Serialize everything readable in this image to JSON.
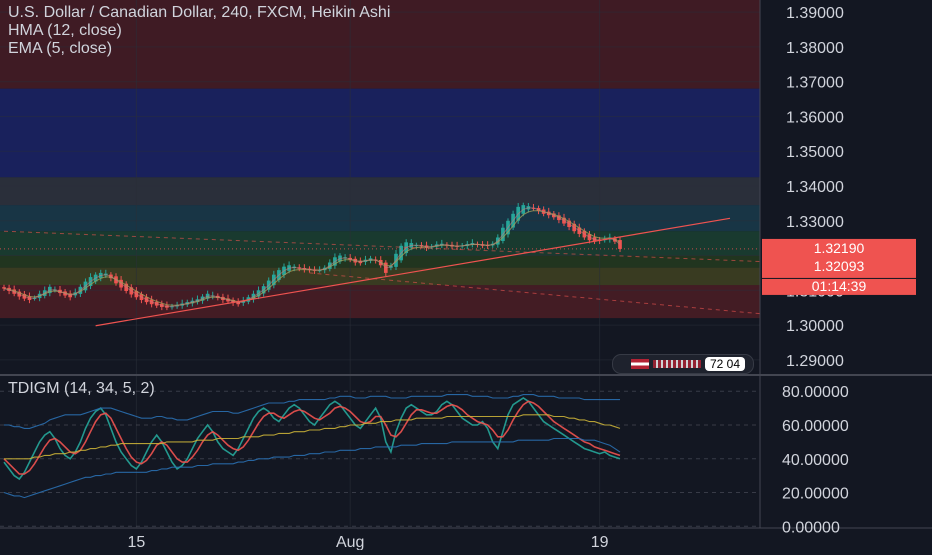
{
  "legend": {
    "main": "U.S. Dollar / Canadian Dollar, 240, FXCM, Heikin Ashi",
    "hma": "HMA (12, close)",
    "ema": "EMA (5, close)",
    "indicator": "TDIGM (14, 34, 5, 2)"
  },
  "price_tags": {
    "last": "1.32190",
    "second": "1.32093",
    "countdown": "01:14:39"
  },
  "logo": {
    "text": "72 04"
  },
  "colors": {
    "background": "#131722",
    "up": "#26a69a",
    "down": "#ef5350",
    "axis_text": "#d1d4dc",
    "price_tag_bg": "#ef5350",
    "tdi_green": "#26a69a",
    "tdi_red": "#ef5350",
    "tdi_yellow": "#c9b037",
    "tdi_bands": "#2a6fb0",
    "trendline": "#ef5350"
  },
  "chart_data": [
    {
      "type": "candlestick",
      "title": "U.S. Dollar / Canadian Dollar, 240, FXCM, Heikin Ashi",
      "y_ticks": [
        "1.39000",
        "1.38000",
        "1.37000",
        "1.36000",
        "1.35000",
        "1.34000",
        "1.33000",
        "1.32000",
        "1.31000",
        "1.30000",
        "1.29000"
      ],
      "ylim": [
        1.2865,
        1.3935
      ],
      "x_ticks": [
        "15",
        "Aug",
        "19"
      ],
      "x_tick_positions": [
        26,
        68,
        117
      ],
      "bar_count": 122,
      "zones": [
        {
          "from": 1.368,
          "to": 1.3935,
          "color": "#b2272c",
          "alpha": 0.28
        },
        {
          "from": 1.3425,
          "to": 1.368,
          "color": "#1f2a8c",
          "alpha": 0.55
        },
        {
          "from": 1.3345,
          "to": 1.3425,
          "color": "#3a3f4b",
          "alpha": 0.6
        },
        {
          "from": 1.327,
          "to": 1.3345,
          "color": "#1d4e63",
          "alpha": 0.55
        },
        {
          "from": 1.32,
          "to": 1.327,
          "color": "#1e5238",
          "alpha": 0.6
        },
        {
          "from": 1.3165,
          "to": 1.32,
          "color": "#2c4a1e",
          "alpha": 0.6
        },
        {
          "from": 1.3115,
          "to": 1.3165,
          "color": "#545422",
          "alpha": 0.6
        },
        {
          "from": 1.302,
          "to": 1.3115,
          "color": "#b2272c",
          "alpha": 0.3
        }
      ],
      "close": [
        1.3105,
        1.3098,
        1.309,
        1.3082,
        1.3076,
        1.3072,
        1.3078,
        1.309,
        1.31,
        1.311,
        1.3102,
        1.3092,
        1.3085,
        1.308,
        1.3094,
        1.311,
        1.3125,
        1.3138,
        1.3145,
        1.315,
        1.3148,
        1.3135,
        1.312,
        1.3108,
        1.3098,
        1.3088,
        1.308,
        1.3072,
        1.3066,
        1.306,
        1.3056,
        1.3052,
        1.305,
        1.3054,
        1.3058,
        1.3062,
        1.3066,
        1.307,
        1.3074,
        1.3082,
        1.309,
        1.3085,
        1.3078,
        1.3072,
        1.3068,
        1.3064,
        1.306,
        1.307,
        1.308,
        1.309,
        1.31,
        1.3112,
        1.3128,
        1.3145,
        1.3158,
        1.3168,
        1.3172,
        1.3168,
        1.3162,
        1.316,
        1.3158,
        1.3156,
        1.3158,
        1.3165,
        1.318,
        1.3195,
        1.32,
        1.3195,
        1.3188,
        1.318,
        1.3178,
        1.3188,
        1.3192,
        1.3186,
        1.3172,
        1.315,
        1.317,
        1.3205,
        1.3228,
        1.3238,
        1.3236,
        1.323,
        1.3228,
        1.3222,
        1.3226,
        1.3232,
        1.3234,
        1.323,
        1.3226,
        1.3225,
        1.3229,
        1.3233,
        1.3236,
        1.3232,
        1.3228,
        1.3228,
        1.3234,
        1.3252,
        1.328,
        1.33,
        1.332,
        1.334,
        1.3345,
        1.3342,
        1.3336,
        1.3328,
        1.332,
        1.3316,
        1.331,
        1.3302,
        1.3292,
        1.3282,
        1.327,
        1.3262,
        1.3252,
        1.3244,
        1.324,
        1.3242,
        1.3248,
        1.3252,
        1.324,
        1.3219
      ],
      "last_price": 1.3219,
      "second_price": 1.32093,
      "trendline": [
        {
          "bar": 18,
          "price": 1.2998
        },
        {
          "bar": 121,
          "price": 1.3307
        }
      ],
      "dashed_lines": [
        {
          "from": {
            "bar": 0,
            "price": 1.327
          },
          "to": {
            "bar": 121,
            "price": 1.32
          },
          "color": "#ef5350"
        },
        {
          "from": {
            "bar": 60,
            "price": 1.315
          },
          "to": {
            "bar": 121,
            "price": 1.305
          },
          "color": "#ef5350"
        }
      ]
    },
    {
      "type": "line",
      "title": "TDIGM (14, 34, 5, 2)",
      "y_ticks": [
        "80.00000",
        "60.00000",
        "40.00000",
        "20.00000",
        "0.00000"
      ],
      "ylim": [
        -1,
        89
      ],
      "series": [
        {
          "role": "rsi",
          "values": [
            38,
            34,
            30,
            28,
            32,
            38,
            44,
            50,
            54,
            56,
            52,
            46,
            42,
            40,
            44,
            50,
            58,
            64,
            68,
            70,
            66,
            58,
            50,
            44,
            40,
            36,
            34,
            38,
            44,
            50,
            54,
            50,
            44,
            38,
            34,
            36,
            40,
            46,
            52,
            56,
            60,
            56,
            50,
            46,
            44,
            42,
            46,
            52,
            58,
            64,
            68,
            70,
            68,
            64,
            62,
            66,
            70,
            72,
            70,
            66,
            62,
            60,
            64,
            68,
            72,
            74,
            72,
            68,
            64,
            60,
            58,
            62,
            66,
            70,
            64,
            50,
            44,
            56,
            64,
            70,
            72,
            70,
            68,
            66,
            66,
            68,
            72,
            74,
            72,
            68,
            64,
            62,
            60,
            60,
            62,
            58,
            50,
            46,
            56,
            66,
            72,
            74,
            76,
            74,
            70,
            66,
            62,
            60,
            58,
            56,
            54,
            52,
            50,
            48,
            46,
            45,
            44,
            43,
            44,
            42,
            41,
            40
          ]
        },
        {
          "role": "signal",
          "values": [
            40,
            37,
            34,
            31,
            31,
            33,
            37,
            42,
            47,
            51,
            52,
            50,
            47,
            44,
            43,
            45,
            50,
            56,
            62,
            66,
            67,
            64,
            58,
            52,
            46,
            41,
            38,
            37,
            39,
            43,
            48,
            50,
            48,
            44,
            40,
            38,
            38,
            41,
            45,
            50,
            54,
            56,
            54,
            51,
            48,
            46,
            45,
            47,
            51,
            56,
            61,
            65,
            67,
            67,
            65,
            64,
            66,
            68,
            69,
            68,
            66,
            64,
            63,
            65,
            67,
            70,
            71,
            70,
            68,
            65,
            62,
            61,
            62,
            65,
            65,
            60,
            54,
            53,
            56,
            61,
            66,
            69,
            69,
            68,
            67,
            67,
            69,
            71,
            72,
            71,
            69,
            66,
            64,
            62,
            61,
            60,
            57,
            53,
            53,
            57,
            63,
            68,
            72,
            74,
            73,
            71,
            68,
            65,
            62,
            60,
            58,
            56,
            54,
            52,
            50,
            49,
            47,
            46,
            45,
            44,
            43,
            42
          ]
        },
        {
          "role": "baseline",
          "values": [
            40,
            40,
            40,
            40,
            40,
            40,
            41,
            41,
            42,
            42,
            43,
            43,
            43,
            44,
            44,
            45,
            45,
            46,
            46,
            47,
            47,
            48,
            48,
            49,
            49,
            49,
            49,
            49,
            49,
            49,
            49,
            49,
            50,
            50,
            50,
            50,
            50,
            50,
            51,
            51,
            51,
            51,
            52,
            52,
            52,
            52,
            52,
            53,
            53,
            53,
            53,
            54,
            54,
            54,
            55,
            55,
            55,
            56,
            56,
            56,
            57,
            57,
            57,
            58,
            58,
            58,
            59,
            59,
            60,
            60,
            60,
            61,
            61,
            61,
            62,
            62,
            62,
            63,
            63,
            63,
            63,
            64,
            64,
            64,
            64,
            64,
            64,
            65,
            65,
            65,
            65,
            65,
            65,
            65,
            65,
            65,
            65,
            65,
            65,
            65,
            65,
            65,
            66,
            66,
            66,
            66,
            66,
            66,
            65,
            65,
            65,
            64,
            64,
            63,
            63,
            62,
            62,
            61,
            60,
            60,
            59,
            58
          ]
        },
        {
          "role": "upper_band",
          "values": [
            60,
            60,
            59,
            59,
            58,
            58,
            59,
            60,
            61,
            63,
            64,
            65,
            66,
            66,
            66,
            66,
            67,
            68,
            69,
            70,
            70,
            70,
            69,
            68,
            67,
            66,
            65,
            64,
            64,
            64,
            65,
            65,
            64,
            64,
            63,
            63,
            63,
            64,
            65,
            66,
            67,
            68,
            68,
            68,
            68,
            67,
            67,
            68,
            69,
            70,
            71,
            72,
            73,
            73,
            73,
            73,
            74,
            74,
            75,
            75,
            75,
            75,
            75,
            75,
            76,
            76,
            77,
            77,
            77,
            76,
            76,
            76,
            77,
            77,
            77,
            77,
            76,
            76,
            76,
            76,
            77,
            77,
            77,
            77,
            77,
            77,
            77,
            78,
            78,
            78,
            78,
            78,
            77,
            77,
            77,
            77,
            76,
            76,
            76,
            76,
            77,
            77,
            78,
            78,
            78,
            77,
            77,
            77,
            77,
            76,
            76,
            76,
            76,
            76,
            75,
            75,
            75,
            75,
            75,
            75,
            75,
            75
          ]
        },
        {
          "role": "lower_band",
          "values": [
            20,
            19,
            18,
            18,
            17,
            18,
            19,
            20,
            21,
            22,
            23,
            24,
            25,
            26,
            27,
            28,
            29,
            29,
            30,
            30,
            31,
            31,
            32,
            32,
            32,
            32,
            32,
            32,
            32,
            33,
            33,
            34,
            34,
            35,
            35,
            35,
            35,
            35,
            36,
            36,
            36,
            37,
            37,
            37,
            37,
            37,
            38,
            38,
            39,
            39,
            40,
            40,
            40,
            41,
            41,
            41,
            41,
            42,
            42,
            42,
            43,
            43,
            43,
            44,
            44,
            44,
            45,
            45,
            45,
            45,
            46,
            46,
            46,
            47,
            47,
            47,
            47,
            47,
            48,
            48,
            48,
            48,
            49,
            49,
            49,
            49,
            49,
            49,
            50,
            50,
            50,
            50,
            50,
            50,
            50,
            50,
            50,
            50,
            50,
            50,
            50,
            51,
            51,
            51,
            51,
            51,
            51,
            51,
            52,
            52,
            52,
            52,
            52,
            52,
            51,
            51,
            51,
            50,
            49,
            48,
            46,
            44
          ]
        }
      ]
    }
  ]
}
